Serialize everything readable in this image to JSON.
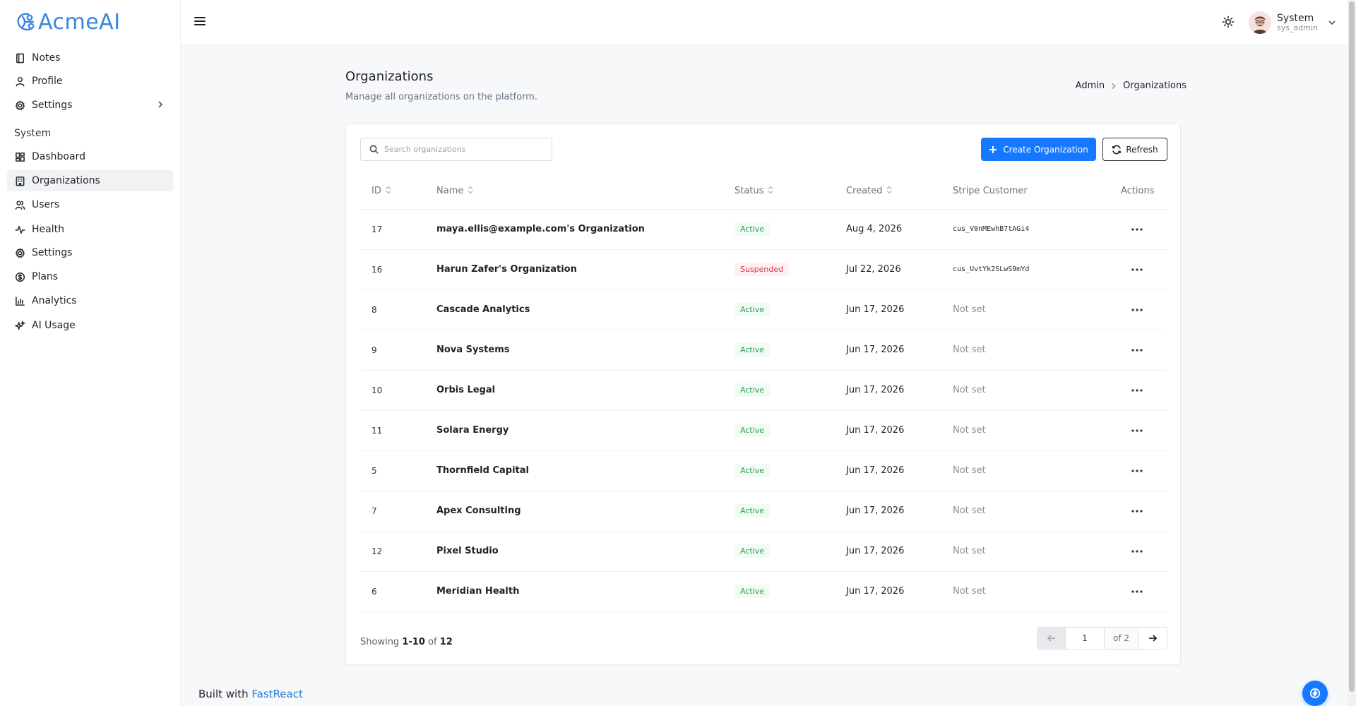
{
  "app": {
    "logo_text": "AcmeAI",
    "accent_color": "#1677ff"
  },
  "sidebar": {
    "items": [
      {
        "label": "Notes",
        "icon": "notebook-icon"
      },
      {
        "label": "Profile",
        "icon": "user-icon"
      },
      {
        "label": "Settings",
        "icon": "gear-icon"
      }
    ],
    "section_label": "System",
    "system_items": [
      {
        "label": "Dashboard",
        "icon": "dashboard-icon"
      },
      {
        "label": "Organizations",
        "icon": "building-icon",
        "active": true
      },
      {
        "label": "Users",
        "icon": "users-icon"
      },
      {
        "label": "Health",
        "icon": "activity-icon"
      },
      {
        "label": "Settings",
        "icon": "gear-icon"
      },
      {
        "label": "Plans",
        "icon": "dollar-icon"
      },
      {
        "label": "Analytics",
        "icon": "bar-chart-icon"
      },
      {
        "label": "AI Usage",
        "icon": "sparkles-icon"
      }
    ]
  },
  "header": {
    "user_name": "System",
    "user_role": "sys_admin"
  },
  "page": {
    "title": "Organizations",
    "subtitle": "Manage all organizations on the platform.",
    "breadcrumb": [
      "Admin",
      "Organizations"
    ]
  },
  "toolbar": {
    "search_placeholder": "Search organizations",
    "create_label": "Create Organization",
    "refresh_label": "Refresh"
  },
  "table": {
    "columns": [
      "ID",
      "Name",
      "Status",
      "Created",
      "Stripe Customer",
      "Actions"
    ],
    "rows": [
      {
        "id": "17",
        "name": "maya.ellis@example.com's Organization",
        "status": "Active",
        "created": "Aug 4, 2026",
        "stripe": "cus_V0nMEwhB7tAGi4"
      },
      {
        "id": "16",
        "name": "Harun Zafer's Organization",
        "status": "Suspended",
        "created": "Jul 22, 2026",
        "stripe": "cus_UvtYk2SLwS9mYd"
      },
      {
        "id": "8",
        "name": "Cascade Analytics",
        "status": "Active",
        "created": "Jun 17, 2026",
        "stripe": "Not set"
      },
      {
        "id": "9",
        "name": "Nova Systems",
        "status": "Active",
        "created": "Jun 17, 2026",
        "stripe": "Not set"
      },
      {
        "id": "10",
        "name": "Orbis Legal",
        "status": "Active",
        "created": "Jun 17, 2026",
        "stripe": "Not set"
      },
      {
        "id": "11",
        "name": "Solara Energy",
        "status": "Active",
        "created": "Jun 17, 2026",
        "stripe": "Not set"
      },
      {
        "id": "5",
        "name": "Thornfield Capital",
        "status": "Active",
        "created": "Jun 17, 2026",
        "stripe": "Not set"
      },
      {
        "id": "7",
        "name": "Apex Consulting",
        "status": "Active",
        "created": "Jun 17, 2026",
        "stripe": "Not set"
      },
      {
        "id": "12",
        "name": "Pixel Studio",
        "status": "Active",
        "created": "Jun 17, 2026",
        "stripe": "Not set"
      },
      {
        "id": "6",
        "name": "Meridian Health",
        "status": "Active",
        "created": "Jun 17, 2026",
        "stripe": "Not set"
      }
    ]
  },
  "pagination": {
    "showing_prefix": "Showing",
    "range": "1-10",
    "of_word": "of",
    "total": "12",
    "current_page": "1",
    "of_pages": "of 2"
  },
  "footer": {
    "text": "Built with",
    "link": "FastReact"
  }
}
